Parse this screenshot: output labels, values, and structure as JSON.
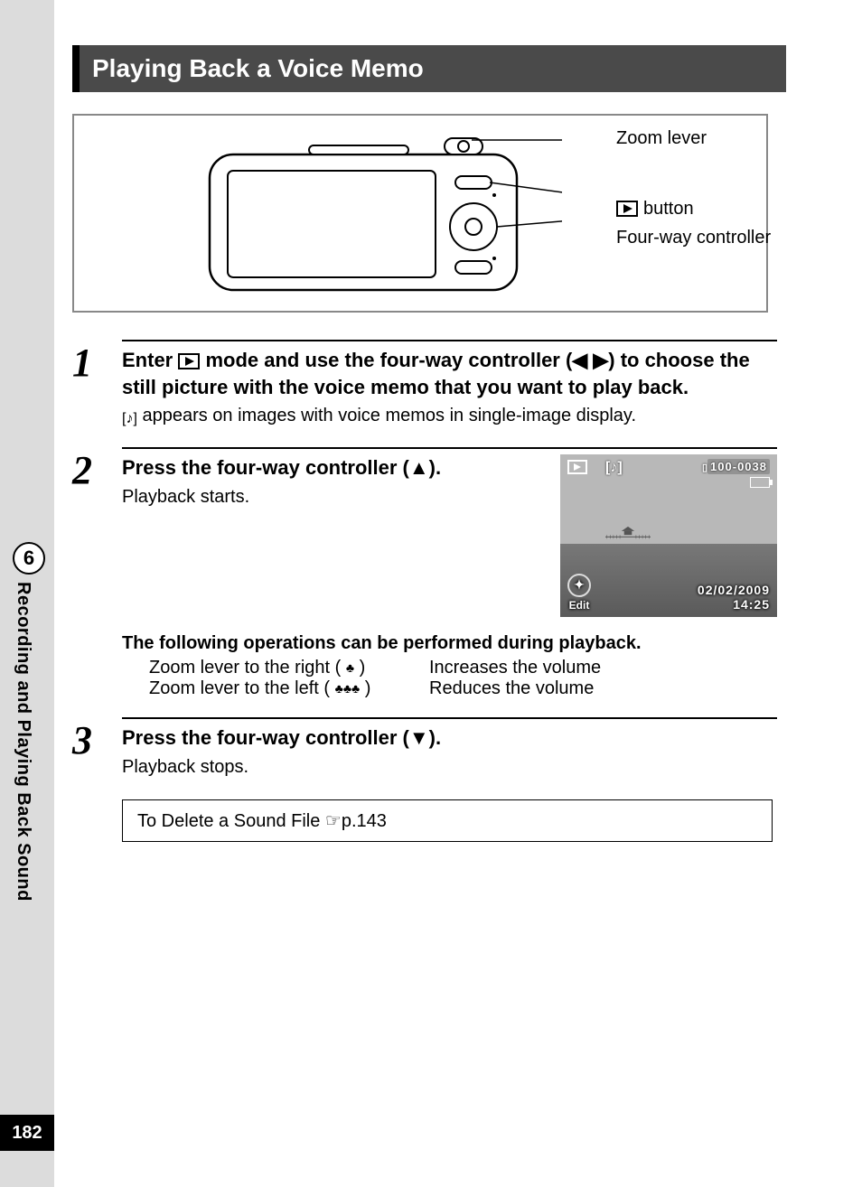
{
  "page_number": "182",
  "section": {
    "number": "6",
    "title": "Recording and Playing Back Sound"
  },
  "header": "Playing Back a Voice Memo",
  "diagram": {
    "label_zoom": "Zoom lever",
    "label_play_button": " button",
    "label_controller": "Four-way controller"
  },
  "steps": {
    "s1": {
      "num": "1",
      "title_pre": "Enter ",
      "title_mid": " mode and use the four-way controller (◀ ▶) to choose the still picture with the voice memo that you want to play back.",
      "desc_post": " appears on images with voice memos in single-image display."
    },
    "s2": {
      "num": "2",
      "title": "Press the four-way controller (▲).",
      "desc": "Playback starts."
    },
    "s3": {
      "num": "3",
      "title": "Press the four-way controller (▼).",
      "desc": "Playback stops."
    }
  },
  "ops": {
    "title": "The following operations can be performed during playback.",
    "row1_left_pre": "Zoom lever to the right (",
    "row1_left_post": ")",
    "row1_right": "Increases the volume",
    "row2_left_pre": "Zoom lever to the left (",
    "row2_left_post": ")",
    "row2_right": "Reduces the volume"
  },
  "screenshot": {
    "file_id": "100-0038",
    "edit_label": "Edit",
    "date": "02/02/2009",
    "time": "14:25"
  },
  "linkbox": {
    "text_pre": "To Delete a Sound File ",
    "pointer": "☞",
    "page_ref": "p.143"
  }
}
